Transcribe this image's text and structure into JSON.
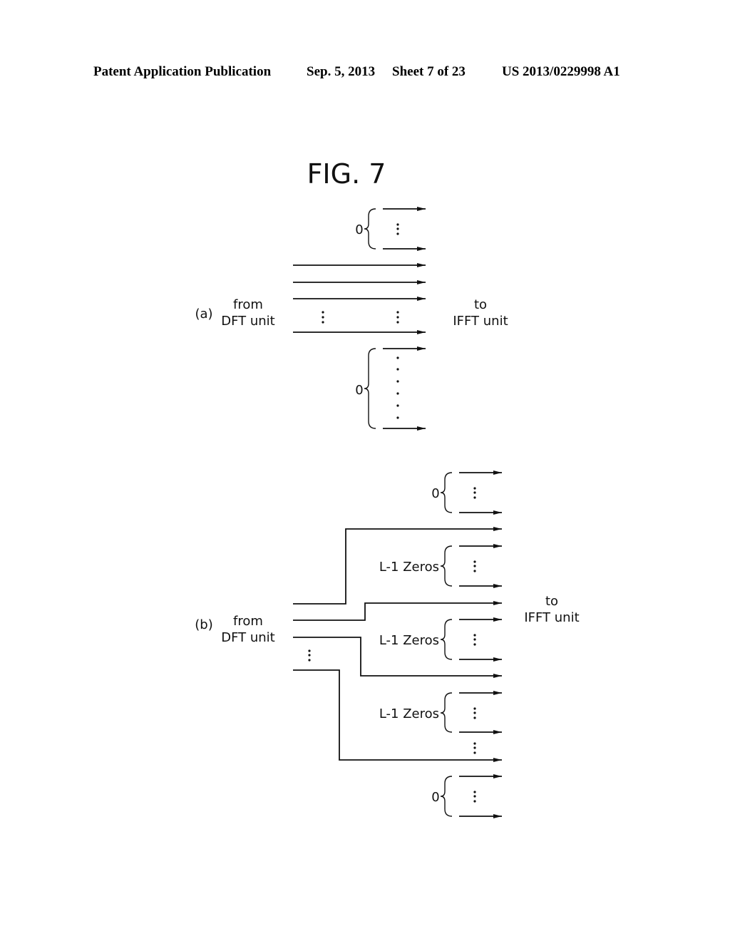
{
  "header": {
    "left": "Patent Application Publication",
    "date": "Sep. 5, 2013",
    "sheet": "Sheet 7 of 23",
    "number": "US 2013/0229998 A1"
  },
  "figure": {
    "title": "FIG. 7",
    "panel_a": {
      "label": "(a)",
      "source_line1": "from",
      "source_line2": "DFT unit",
      "dest_line1": "to",
      "dest_line2": "IFFT unit",
      "top_group_label": "0",
      "bottom_group_label": "0"
    },
    "panel_b": {
      "label": "(b)",
      "source_line1": "from",
      "source_line2": "DFT unit",
      "dest_line1": "to",
      "dest_line2": "IFFT unit",
      "top_group_label": "0",
      "zero_groups": [
        "L-1 Zeros",
        "L-1 Zeros",
        "L-1 Zeros"
      ],
      "bottom_group_label": "0"
    },
    "vdots": "⋮"
  }
}
